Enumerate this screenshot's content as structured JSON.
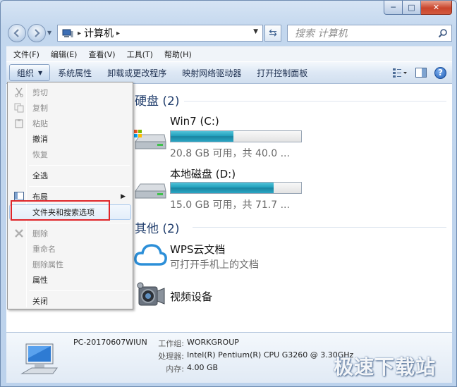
{
  "window": {
    "caption": {
      "minimize": "─",
      "maximize": "□",
      "close": "✕"
    }
  },
  "address_bar": {
    "crumb": "计算机",
    "search_placeholder": "搜索 计算机"
  },
  "menubar": {
    "items": [
      "文件(F)",
      "编辑(E)",
      "查看(V)",
      "工具(T)",
      "帮助(H)"
    ]
  },
  "toolbar": {
    "organize": "组织",
    "items": [
      "系统属性",
      "卸载或更改程序",
      "映射网络驱动器",
      "打开控制面板"
    ]
  },
  "content": {
    "groups": {
      "drives_header": "硬盘 (2)",
      "other_header": "其他 (2)"
    },
    "drives": [
      {
        "name": "Win7 (C:)",
        "meta": "20.8 GB 可用，共 40.0 ...",
        "used_fraction": 0.48
      },
      {
        "name": "本地磁盘 (D:)",
        "meta": "15.0 GB 可用，共 71.7 ...",
        "used_fraction": 0.79
      }
    ],
    "other": [
      {
        "name": "WPS云文档",
        "sub": "可打开手机上的文档"
      },
      {
        "name": "视频设备",
        "sub": ""
      }
    ]
  },
  "details": {
    "pc_name": "PC-20170607WIUN",
    "workgroup_label": "工作组:",
    "workgroup_value": "WORKGROUP",
    "processor_label": "处理器:",
    "processor_value": "Intel(R) Pentium(R) CPU G3260 @ 3.30GHz",
    "memory_label": "内存:",
    "memory_value": "4.00 GB"
  },
  "context_menu": {
    "items": [
      {
        "label": "剪切",
        "disabled": true
      },
      {
        "label": "复制",
        "disabled": true
      },
      {
        "label": "粘贴",
        "disabled": true
      },
      {
        "label": "撤消",
        "disabled": false
      },
      {
        "label": "恢复",
        "disabled": true
      },
      {
        "label": "全选",
        "disabled": false
      },
      {
        "label": "布局",
        "disabled": false
      },
      {
        "label": "文件夹和搜索选项",
        "disabled": false
      },
      {
        "label": "删除",
        "disabled": true
      },
      {
        "label": "重命名",
        "disabled": true
      },
      {
        "label": "删除属性",
        "disabled": true
      },
      {
        "label": "属性",
        "disabled": false
      },
      {
        "label": "关闭",
        "disabled": false
      }
    ],
    "highlight_color": "#e0252a"
  },
  "watermark": "极速下载站"
}
